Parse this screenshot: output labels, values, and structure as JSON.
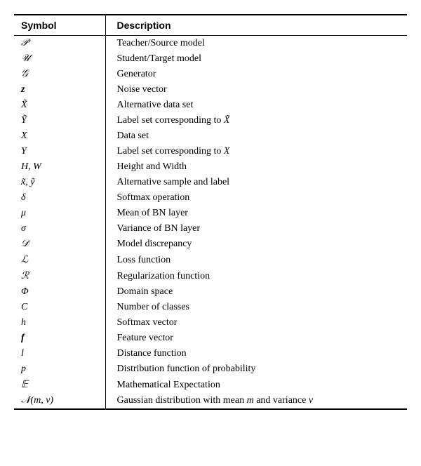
{
  "table": {
    "headers": {
      "symbol": "Symbol",
      "description": "Description"
    },
    "rows": [
      {
        "symbol_html": "&#119979;",
        "symbol_type": "cal",
        "description": "Teacher/Source model"
      },
      {
        "symbol_html": "&#119984;",
        "symbol_type": "cal",
        "description": "Student/Target model"
      },
      {
        "symbol_html": "&#119970;",
        "symbol_type": "cal",
        "description": "Generator"
      },
      {
        "symbol_html": "<b><i>z</i></b>",
        "symbol_type": "bold",
        "description": "Noise vector"
      },
      {
        "symbol_html": "<i>X&#771;</i>",
        "symbol_type": "normal",
        "description": "Alternative data set"
      },
      {
        "symbol_html": "<i>Y&#771;</i>",
        "symbol_type": "normal",
        "description": "Label set corresponding to <i>X&#771;</i>"
      },
      {
        "symbol_html": "<i>X</i>",
        "symbol_type": "normal",
        "description": "Data set"
      },
      {
        "symbol_html": "<i>Y</i>",
        "symbol_type": "normal",
        "description": "Label set corresponding to <i>X</i>"
      },
      {
        "symbol_html": "<i>H</i>, <i>W</i>",
        "symbol_type": "normal",
        "description": "Height and Width"
      },
      {
        "symbol_html": "<i>x&#771;</i>, <i>y&#771;</i>",
        "symbol_type": "normal",
        "description": "Alternative sample and label"
      },
      {
        "symbol_html": "<i>&#948;</i>",
        "symbol_type": "normal",
        "description": "Softmax operation"
      },
      {
        "symbol_html": "<i>&#956;</i>",
        "symbol_type": "normal",
        "description": "Mean of BN layer"
      },
      {
        "symbol_html": "<i>&#963;</i>",
        "symbol_type": "normal",
        "description": "Variance of BN layer"
      },
      {
        "symbol_html": "&#119967;",
        "symbol_type": "cal",
        "description": "Model discrepancy"
      },
      {
        "symbol_html": "&#8466;",
        "symbol_type": "cal",
        "description": "Loss function"
      },
      {
        "symbol_html": "&#8475;",
        "symbol_type": "cal",
        "description": "Regularization function"
      },
      {
        "symbol_html": "<i>&#934;</i>",
        "symbol_type": "normal",
        "description": "Domain space"
      },
      {
        "symbol_html": "<i>C</i>",
        "symbol_type": "normal",
        "description": "Number of classes"
      },
      {
        "symbol_html": "<i>h</i>",
        "symbol_type": "normal",
        "description": "Softmax vector"
      },
      {
        "symbol_html": "<b><i>f</i></b>",
        "symbol_type": "bold",
        "description": "Feature vector"
      },
      {
        "symbol_html": "<i>l</i>",
        "symbol_type": "normal",
        "description": "Distance function"
      },
      {
        "symbol_html": "<i>p</i>",
        "symbol_type": "normal",
        "description": "Distribution function of probability"
      },
      {
        "symbol_html": "&#120124;",
        "symbol_type": "bb",
        "description": "Mathematical Expectation"
      },
      {
        "symbol_html": "&#119977;(<i>m</i>, <i>v</i>)",
        "symbol_type": "cal",
        "description": "Gaussian distribution with mean <i>m</i> and variance <i>v</i>"
      }
    ]
  }
}
